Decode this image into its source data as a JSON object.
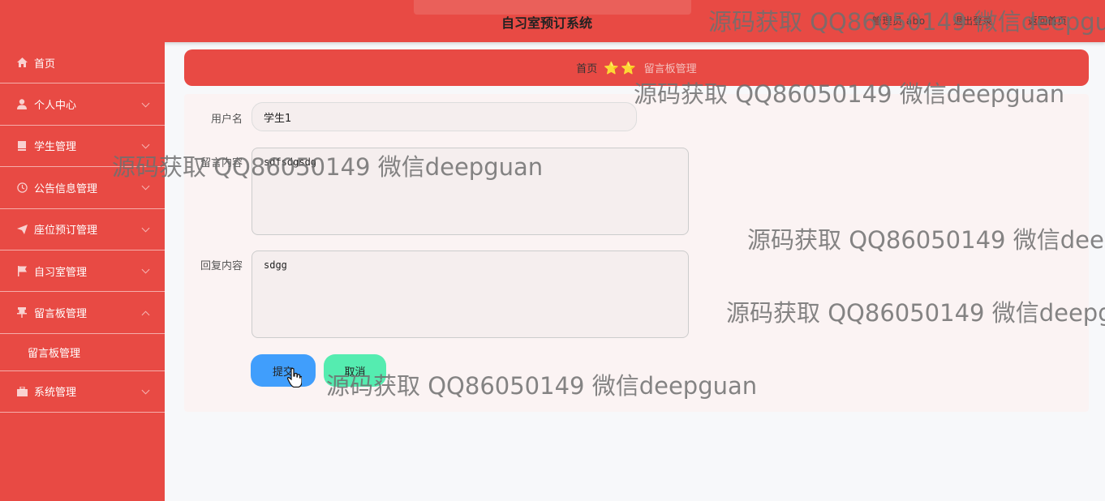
{
  "header": {
    "title": "自习室预订系统",
    "user_info": "管理员 abo",
    "logout": "退出登录",
    "home": "返回首页"
  },
  "sidebar": {
    "items": [
      {
        "label": "首页",
        "icon": "home-icon"
      },
      {
        "label": "个人中心",
        "icon": "user-icon"
      },
      {
        "label": "学生管理",
        "icon": "book-icon"
      },
      {
        "label": "公告信息管理",
        "icon": "clock-icon"
      },
      {
        "label": "座位预订管理",
        "icon": "send-icon"
      },
      {
        "label": "自习室管理",
        "icon": "flag-icon"
      },
      {
        "label": "留言板管理",
        "icon": "pin-icon"
      },
      {
        "label": "系统管理",
        "icon": "briefcase-icon"
      }
    ],
    "submenu": {
      "label": "留言板管理"
    }
  },
  "breadcrumb": {
    "home": "首页",
    "separator": "⭐⭐",
    "current": "留言板管理"
  },
  "form": {
    "username_label": "用户名",
    "username_value": "学生1",
    "message_label": "留言内容",
    "message_value": "sdfsdgsdg",
    "reply_label": "回复内容",
    "reply_value": "sdgg",
    "submit_label": "提交",
    "cancel_label": "取消"
  },
  "watermark": "源码获取 QQ86050149 微信deepguan",
  "colors": {
    "primary": "#e84a44",
    "submit": "#409efc",
    "cancel": "#55ecb0"
  }
}
